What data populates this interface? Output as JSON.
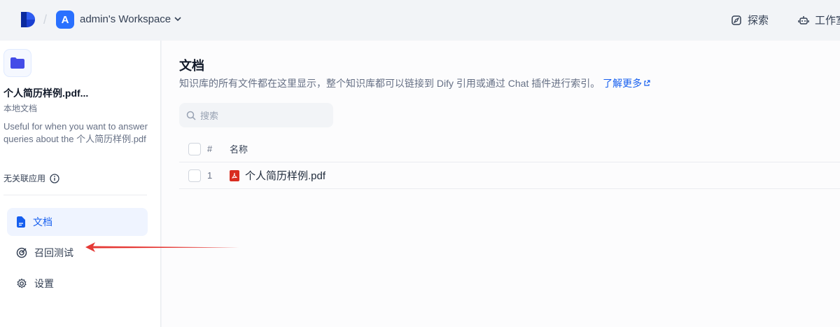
{
  "header": {
    "workspace_initial": "A",
    "workspace_name": "admin's Workspace",
    "nav_explore": "探索",
    "nav_studio": "工作室"
  },
  "sidebar": {
    "dataset_name": "个人简历样例.pdf...",
    "dataset_type": "本地文档",
    "dataset_description": "Useful for when you want to answer queries about the 个人简历样例.pdf",
    "related_apps": "无关联应用",
    "menu": [
      {
        "label": "文档",
        "icon": "document-icon",
        "active": true
      },
      {
        "label": "召回测试",
        "icon": "target-icon",
        "active": false
      },
      {
        "label": "设置",
        "icon": "gear-icon",
        "active": false
      }
    ]
  },
  "main": {
    "title": "文档",
    "description": "知识库的所有文件都在这里显示，整个知识库都可以链接到 Dify 引用或通过 Chat 插件进行索引。",
    "learn_more": "了解更多",
    "search_placeholder": "搜索",
    "table": {
      "columns": [
        "#",
        "名称"
      ],
      "rows": [
        {
          "num": "1",
          "name": "个人简历样例.pdf"
        }
      ]
    }
  },
  "colors": {
    "accent": "#155eef",
    "avatar": "#2970ff",
    "pdf": "#d92d20",
    "annotation_arrow": "#e53935"
  }
}
